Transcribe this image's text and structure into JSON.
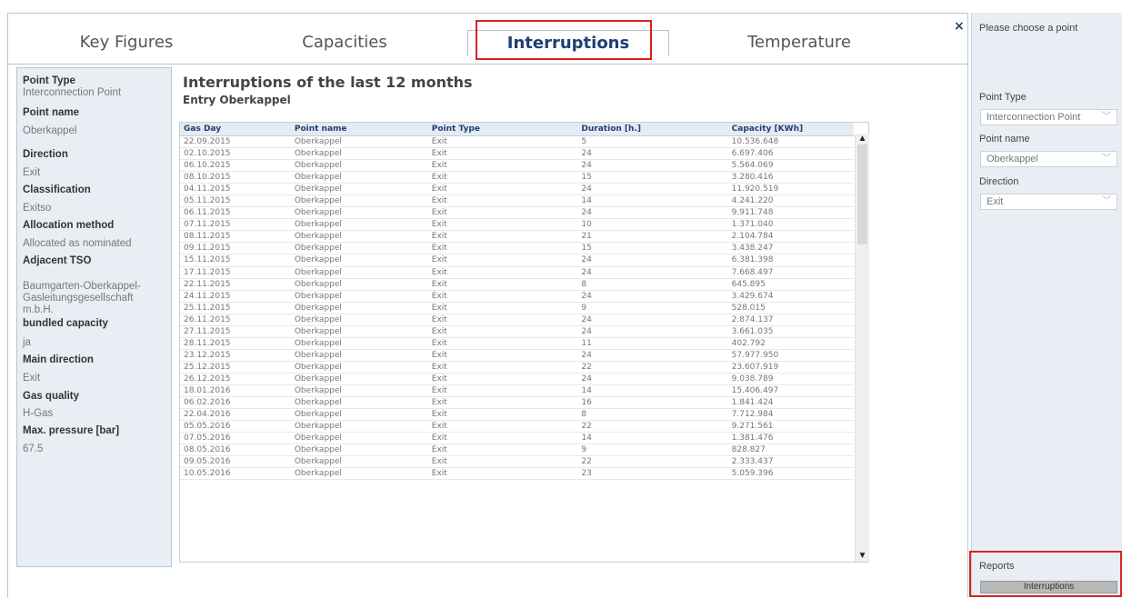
{
  "tabs": [
    "Key Figures",
    "Capacities",
    "Interruptions",
    "Temperature"
  ],
  "close_symbol": "×",
  "left_panel": [
    {
      "label": "Point Type",
      "value": "Interconnection Point"
    },
    {
      "label": "Point name",
      "value": "Oberkappel"
    },
    {
      "label": "Direction",
      "value": "Exit"
    },
    {
      "label": "Classification",
      "value": "Exitso"
    },
    {
      "label": "Allocation method",
      "value": "Allocated as nominated"
    },
    {
      "label": "Adjacent TSO",
      "value": "Baumgarten-Oberkappel-Gasleitungsgesellschaft m.b.H."
    },
    {
      "label": "bundled capacity",
      "value": "ja"
    },
    {
      "label": "Main direction",
      "value": "Exit"
    },
    {
      "label": "Gas quality",
      "value": "H-Gas"
    },
    {
      "label": "Max. pressure [bar]",
      "value": "67.5"
    }
  ],
  "content": {
    "title": "Interruptions of the last 12 months",
    "subtitle": "Entry Oberkappel"
  },
  "table": {
    "headers": [
      "Gas Day",
      "Point name",
      "Point Type",
      "Duration [h.]",
      "Capacity [KWh]"
    ],
    "rows": [
      [
        "22.09.2015",
        "Oberkappel",
        "Exit",
        "5",
        "10.536.648"
      ],
      [
        "02.10.2015",
        "Oberkappel",
        "Exit",
        "24",
        "6.697.406"
      ],
      [
        "06.10.2015",
        "Oberkappel",
        "Exit",
        "24",
        "5.564.069"
      ],
      [
        "08.10.2015",
        "Oberkappel",
        "Exit",
        "15",
        "3.280.416"
      ],
      [
        "04.11.2015",
        "Oberkappel",
        "Exit",
        "24",
        "11.920.519"
      ],
      [
        "05.11.2015",
        "Oberkappel",
        "Exit",
        "14",
        "4.241.220"
      ],
      [
        "06.11.2015",
        "Oberkappel",
        "Exit",
        "24",
        "9.911.748"
      ],
      [
        "07.11.2015",
        "Oberkappel",
        "Exit",
        "10",
        "1.371.040"
      ],
      [
        "08.11.2015",
        "Oberkappel",
        "Exit",
        "21",
        "2.104.784"
      ],
      [
        "09.11.2015",
        "Oberkappel",
        "Exit",
        "15",
        "3.438.247"
      ],
      [
        "15.11.2015",
        "Oberkappel",
        "Exit",
        "24",
        "6.381.398"
      ],
      [
        "17.11.2015",
        "Oberkappel",
        "Exit",
        "24",
        "7.668.497"
      ],
      [
        "22.11.2015",
        "Oberkappel",
        "Exit",
        "8",
        "645.895"
      ],
      [
        "24.11.2015",
        "Oberkappel",
        "Exit",
        "24",
        "3.429.674"
      ],
      [
        "25.11.2015",
        "Oberkappel",
        "Exit",
        "9",
        "528.015"
      ],
      [
        "26.11.2015",
        "Oberkappel",
        "Exit",
        "24",
        "2.874.137"
      ],
      [
        "27.11.2015",
        "Oberkappel",
        "Exit",
        "24",
        "3.661.035"
      ],
      [
        "28.11.2015",
        "Oberkappel",
        "Exit",
        "11",
        "402.792"
      ],
      [
        "23.12.2015",
        "Oberkappel",
        "Exit",
        "24",
        "57.977.950"
      ],
      [
        "25.12.2015",
        "Oberkappel",
        "Exit",
        "22",
        "23.607.919"
      ],
      [
        "26.12.2015",
        "Oberkappel",
        "Exit",
        "24",
        "9.038.789"
      ],
      [
        "18.01.2016",
        "Oberkappel",
        "Exit",
        "14",
        "15.406.497"
      ],
      [
        "06.02.2016",
        "Oberkappel",
        "Exit",
        "16",
        "1.841.424"
      ],
      [
        "22.04.2016",
        "Oberkappel",
        "Exit",
        "8",
        "7.712.984"
      ],
      [
        "05.05.2016",
        "Oberkappel",
        "Exit",
        "22",
        "9.271.561"
      ],
      [
        "07.05.2016",
        "Oberkappel",
        "Exit",
        "14",
        "1.381.476"
      ],
      [
        "08.05.2016",
        "Oberkappel",
        "Exit",
        "9",
        "828.827"
      ],
      [
        "09.05.2016",
        "Oberkappel",
        "Exit",
        "22",
        "2.333.437"
      ],
      [
        "10.05.2016",
        "Oberkappel",
        "Exit",
        "23",
        "5.059.396"
      ]
    ]
  },
  "right_panel": {
    "title": "Please choose a point",
    "point_type_label": "Point Type",
    "point_type_value": "Interconnection Point",
    "point_name_label": "Point name",
    "point_name_value": "Oberkappel",
    "direction_label": "Direction",
    "direction_value": "Exit",
    "reports_label": "Reports",
    "reports_button": "Interruptions"
  },
  "colors": {
    "accent": "#1e3f73",
    "highlight": "#d92020",
    "panel_bg": "#e9eef5"
  }
}
